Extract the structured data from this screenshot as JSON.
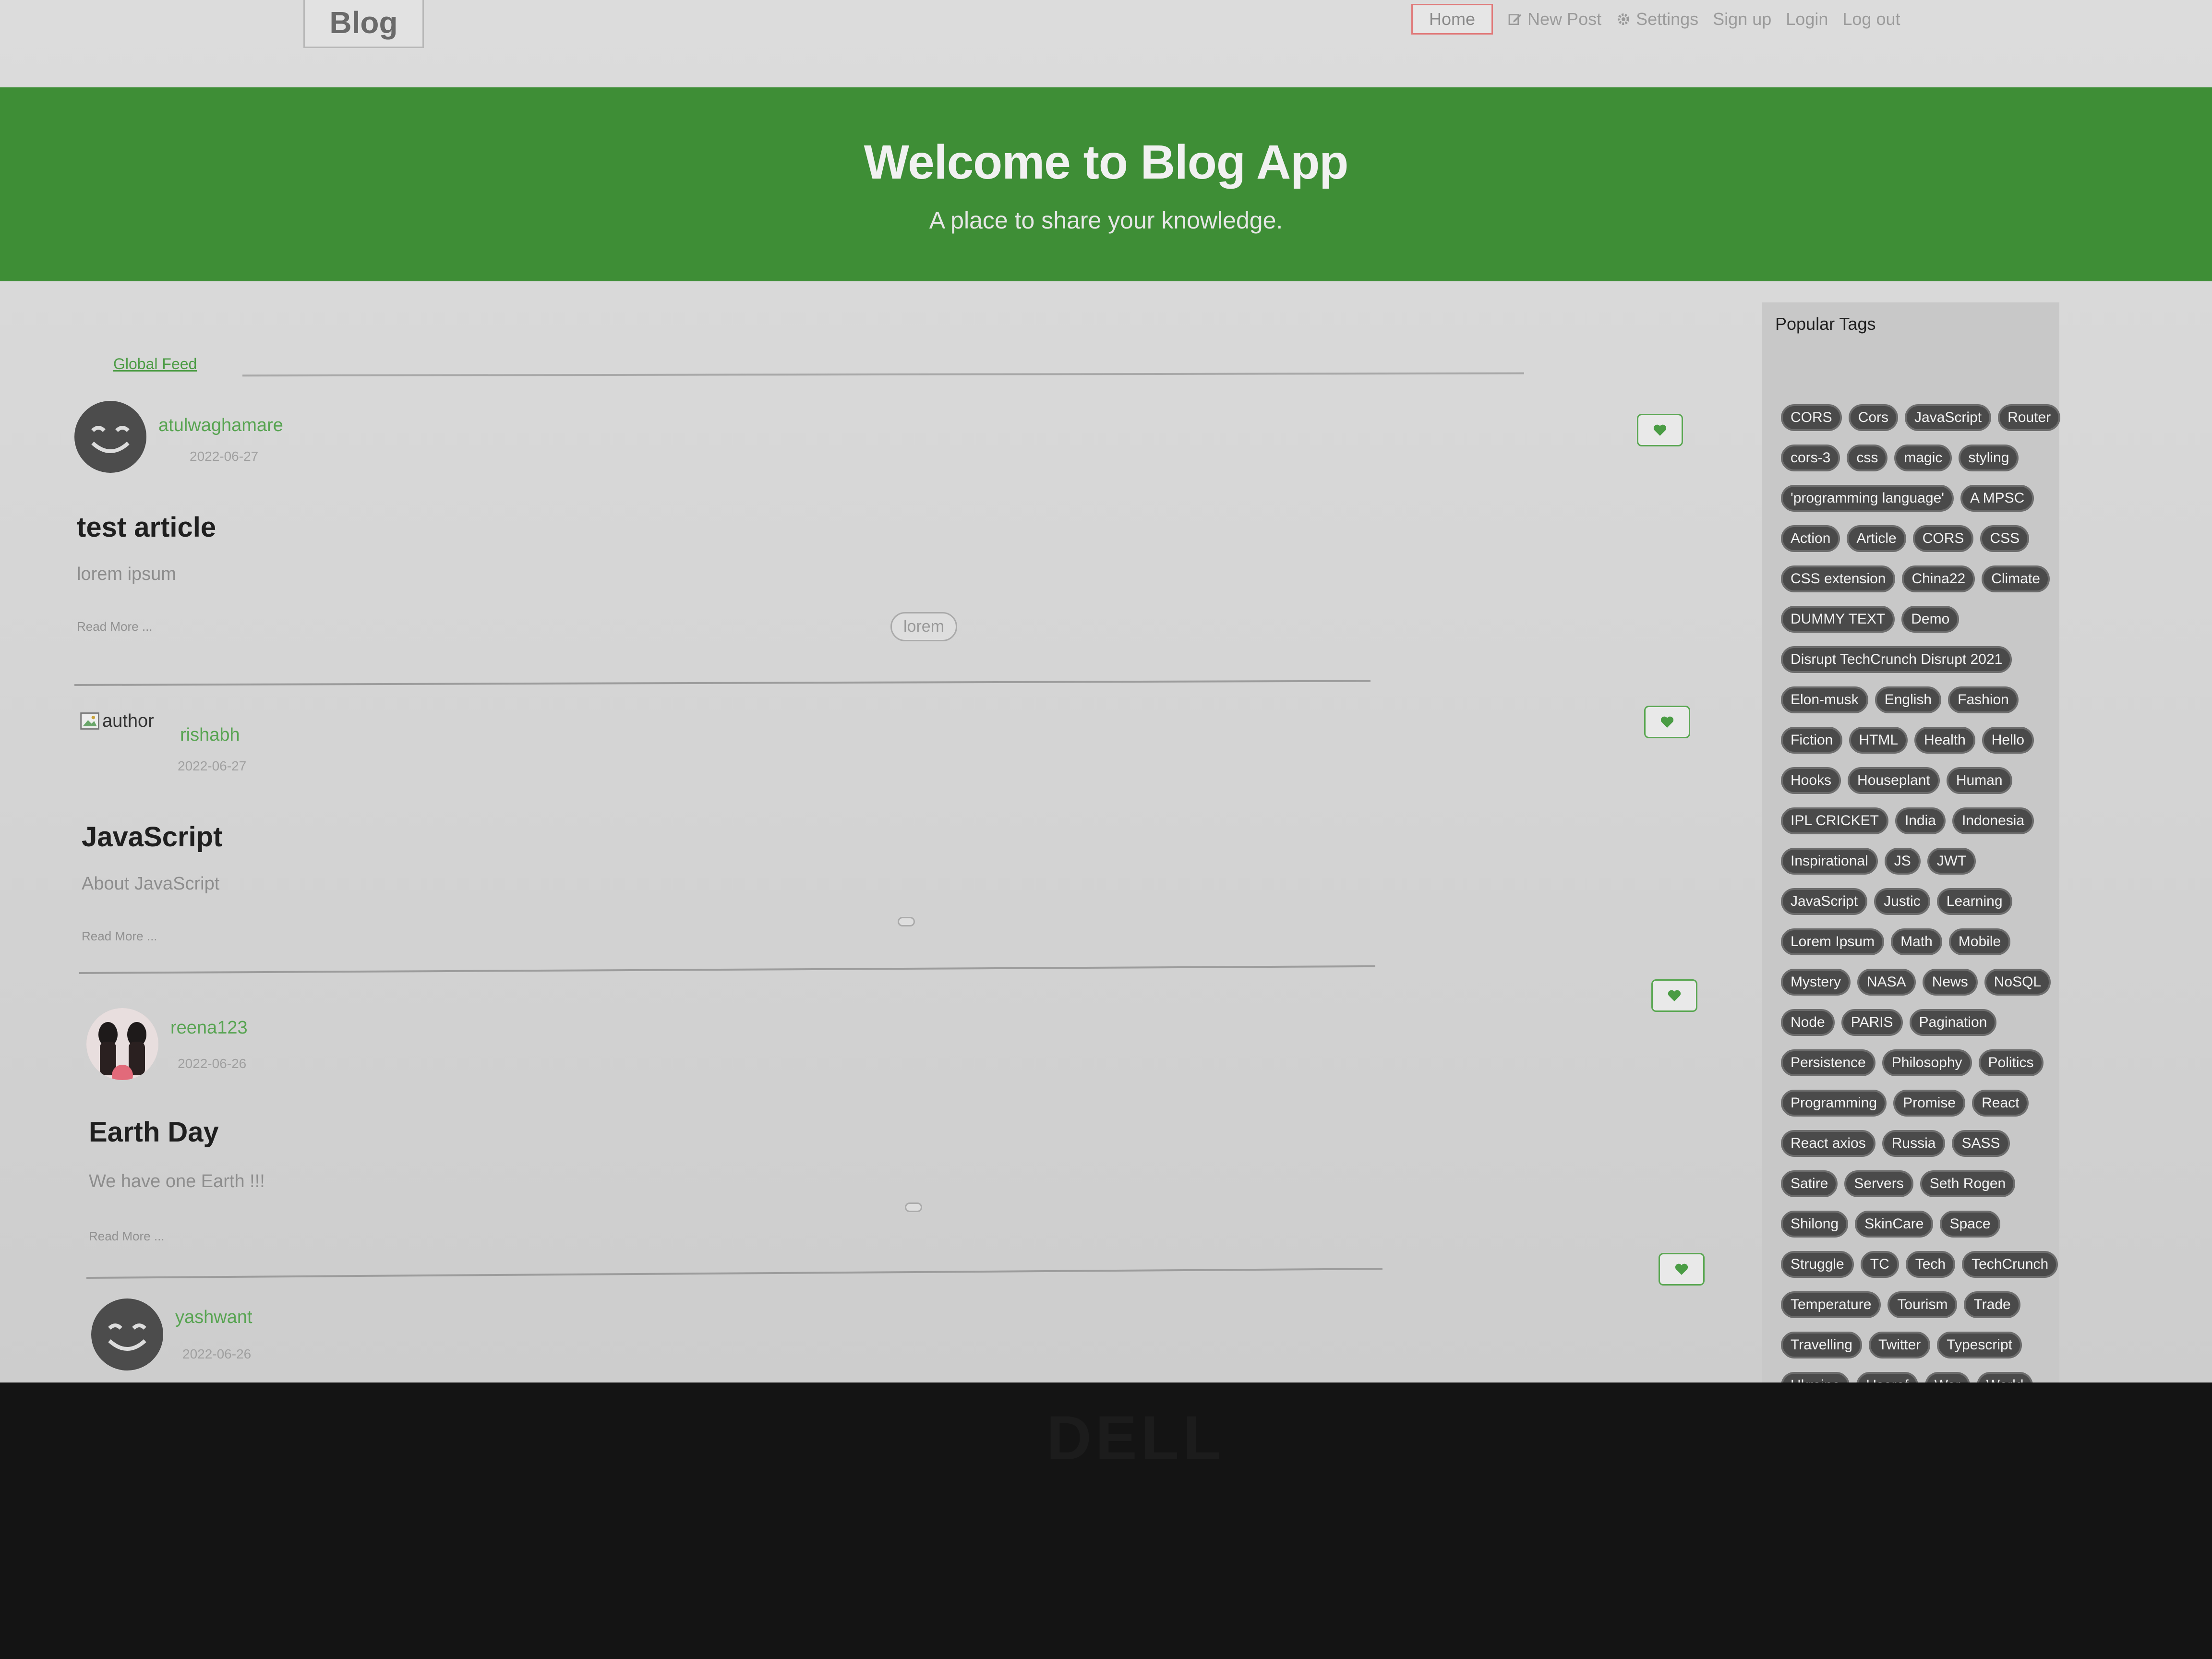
{
  "navbar": {
    "brand": "Blog",
    "items": [
      {
        "label": "Home",
        "icon": ""
      },
      {
        "label": "New Post",
        "icon": "edit-icon"
      },
      {
        "label": "Settings",
        "icon": "gear-icon"
      },
      {
        "label": "Sign up",
        "icon": ""
      },
      {
        "label": "Login",
        "icon": ""
      },
      {
        "label": "Log out",
        "icon": ""
      }
    ]
  },
  "banner": {
    "title": "Welcome to Blog App",
    "subtitle": "A place to share your knowledge."
  },
  "feed": {
    "tab": "Global Feed",
    "articles": [
      {
        "author": "atulwaghamare",
        "date": "2022-06-27",
        "title": "test article",
        "description": "lorem ipsum",
        "read_more": "Read More ...",
        "tag": "lorem",
        "avatar": "smiley-avatar"
      },
      {
        "author": "rishabh",
        "date": "2022-06-27",
        "title": "JavaScript",
        "description": "About JavaScript",
        "read_more": "Read More ...",
        "tag": "",
        "avatar": "broken-image",
        "avatar_alt": "author"
      },
      {
        "author": "reena123",
        "date": "2022-06-26",
        "title": "Earth Day",
        "description": "We have one Earth !!!",
        "read_more": "Read More ...",
        "tag": "",
        "avatar": "people-photo"
      },
      {
        "author": "yashwant",
        "date": "2022-06-26",
        "title": "",
        "description": "",
        "read_more": "",
        "tag": "",
        "avatar": "smiley-avatar"
      }
    ]
  },
  "sidebar": {
    "title": "Popular Tags",
    "tags": [
      "CORS",
      "Cors",
      "JavaScript",
      "Router",
      "cors-3",
      "css",
      "magic",
      "styling",
      "'programming language'",
      "A MPSC",
      "Action",
      "Article",
      "CORS",
      "CSS",
      "CSS extension",
      "China22",
      "Climate",
      "DUMMY TEXT",
      "Demo",
      "Disrupt TechCrunch Disrupt 2021",
      "Elon-musk",
      "English",
      "Fashion",
      "Fiction",
      "HTML",
      "Health",
      "Hello",
      "Hooks",
      "Houseplant",
      "Human",
      "IPL CRICKET",
      "India",
      "Indonesia",
      "Inspirational",
      "JS",
      "JWT",
      "JavaScript",
      "Justic",
      "Learning",
      "Lorem Ipsum",
      "Math",
      "Mobile",
      "Mystery",
      "NASA",
      "News",
      "NoSQL",
      "Node",
      "PARIS",
      "Pagination",
      "Persistence",
      "Philosophy",
      "Politics",
      "Programming",
      "Promise",
      "React",
      "React axios",
      "Russia",
      "SASS",
      "Satire",
      "Servers",
      "Seth Rogen",
      "Shilong",
      "SkinCare",
      "Space",
      "Struggle",
      "TC",
      "Tech",
      "TechCrunch",
      "Temperature",
      "Tourism",
      "Trade",
      "Travelling",
      "Twitter",
      "Typescript",
      "Ukraine",
      "Useref",
      "War",
      "World"
    ]
  },
  "colors": {
    "brand_green": "#3e8e36",
    "link_green": "#58a452",
    "tag_bg": "#4a4a4a"
  }
}
